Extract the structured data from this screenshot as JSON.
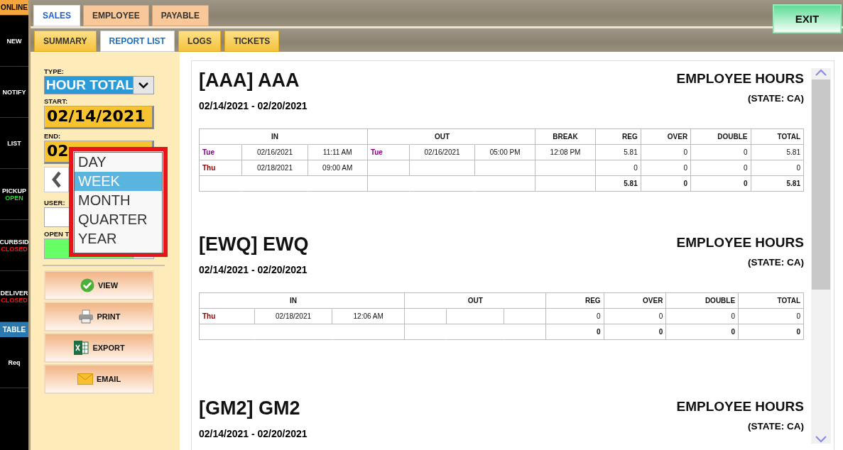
{
  "sidebar": {
    "items": [
      {
        "label": "ONLINE",
        "kind": "mode"
      },
      {
        "label": "NEW",
        "kind": "plain"
      },
      {
        "label": "NOTIFY",
        "kind": "plain"
      },
      {
        "label": "LIST",
        "kind": "plain"
      },
      {
        "label": "PICKUP",
        "kind": "service",
        "status": "OPEN",
        "open": true
      },
      {
        "label": "CURBSID",
        "kind": "service",
        "status": "CLOSED",
        "open": false
      },
      {
        "label": "DELIVER",
        "kind": "service",
        "status": "CLOSED",
        "open": false
      },
      {
        "label": "TABLE",
        "kind": "accent"
      },
      {
        "label": "Req",
        "kind": "plain"
      }
    ]
  },
  "tabs": [
    {
      "label": "SALES",
      "selected": true
    },
    {
      "label": "EMPLOYEE",
      "selected": false
    },
    {
      "label": "PAYABLE",
      "selected": false
    }
  ],
  "subtabs": [
    {
      "label": "SUMMARY",
      "selected": false
    },
    {
      "label": "REPORT LIST",
      "selected": true
    },
    {
      "label": "LOGS",
      "selected": false
    },
    {
      "label": "TICKETS",
      "selected": false
    }
  ],
  "exit_button": "EXIT",
  "filters": {
    "type_label": "TYPE:",
    "type_value": "HOUR TOTAL",
    "start_label": "START:",
    "start_value": "02/14/2021",
    "end_label": "END:",
    "end_value": "02",
    "user_label": "USER:",
    "open_label": "OPEN T"
  },
  "period_menu": [
    {
      "label": "DAY",
      "selected": false
    },
    {
      "label": "WEEK",
      "selected": true
    },
    {
      "label": "MONTH",
      "selected": false
    },
    {
      "label": "QUARTER",
      "selected": false
    },
    {
      "label": "YEAR",
      "selected": false
    }
  ],
  "actions": [
    {
      "label": "VIEW",
      "kind": "view"
    },
    {
      "label": "PRINT",
      "kind": "print"
    },
    {
      "label": "EXPORT",
      "kind": "export"
    },
    {
      "label": "EMAIL",
      "kind": "email"
    }
  ],
  "reports": [
    {
      "code": "[AAA] AAA",
      "heading": "EMPLOYEE HOURS",
      "range": "02/14/2021 - 02/20/2021",
      "state": "(STATE: CA)",
      "table": {
        "columns": [
          {
            "kind": "joined"
          },
          {
            "label": "IN",
            "kind": "joined"
          },
          {
            "kind": "empty"
          },
          {
            "kind": "joined"
          },
          {
            "label": "OUT",
            "kind": "joined"
          },
          {
            "kind": "empty"
          },
          {
            "label": "BREAK",
            "kind": "text"
          },
          {
            "label": "REG",
            "kind": "number"
          },
          {
            "label": "OVER",
            "kind": "number"
          },
          {
            "label": "DOUBLE",
            "kind": "number"
          },
          {
            "label": "TOTAL",
            "kind": "number"
          }
        ],
        "rows": [
          {
            "kind": "entry",
            "cells": [
              {
                "text": "Tue",
                "kind": "day",
                "color": "#800080"
              },
              {
                "text": "02/16/2021",
                "kind": "text"
              },
              {
                "text": "11:11 AM",
                "kind": "text"
              },
              {
                "text": "Tue",
                "kind": "day",
                "color": "#800080"
              },
              {
                "text": "02/16/2021",
                "kind": "text"
              },
              {
                "text": "05:00 PM",
                "kind": "text"
              },
              {
                "text": "12:08 PM",
                "kind": "text"
              },
              {
                "text": "5.81",
                "kind": "number"
              },
              {
                "text": "0",
                "kind": "number"
              },
              {
                "text": "0",
                "kind": "number"
              },
              {
                "text": "5.81",
                "kind": "number"
              }
            ]
          },
          {
            "kind": "entry",
            "cells": [
              {
                "text": "Thu",
                "kind": "day",
                "color": "#8b0000"
              },
              {
                "text": "02/18/2021",
                "kind": "text"
              },
              {
                "text": "09:00 AM",
                "kind": "text"
              },
              {
                "kind": "empty"
              },
              {
                "kind": "empty"
              },
              {
                "kind": "empty"
              },
              {
                "kind": "empty"
              },
              {
                "text": "0",
                "kind": "number"
              },
              {
                "text": "0",
                "kind": "number"
              },
              {
                "text": "0",
                "kind": "number"
              },
              {
                "text": "0",
                "kind": "number"
              }
            ]
          },
          {
            "kind": "total",
            "cells": [
              {
                "kind": "joined"
              },
              {
                "kind": "joined"
              },
              {
                "kind": "empty"
              },
              {
                "kind": "joined"
              },
              {
                "kind": "joined"
              },
              {
                "kind": "empty"
              },
              {
                "kind": "empty"
              },
              {
                "text": "5.81",
                "kind": "number"
              },
              {
                "text": "0",
                "kind": "number"
              },
              {
                "text": "0",
                "kind": "number"
              },
              {
                "text": "5.81",
                "kind": "number"
              }
            ]
          }
        ]
      }
    },
    {
      "code": "[EWQ] EWQ",
      "heading": "EMPLOYEE HOURS",
      "range": "02/14/2021 - 02/20/2021",
      "state": "(STATE: CA)",
      "table": {
        "columns": [
          {
            "kind": "joined"
          },
          {
            "label": "IN",
            "kind": "joined"
          },
          {
            "kind": "empty"
          },
          {
            "kind": "joined"
          },
          {
            "label": "OUT",
            "kind": "joined"
          },
          {
            "kind": "empty"
          },
          {
            "label": "REG",
            "kind": "number"
          },
          {
            "label": "OVER",
            "kind": "number"
          },
          {
            "label": "DOUBLE",
            "kind": "number"
          },
          {
            "label": "TOTAL",
            "kind": "number"
          }
        ],
        "rows": [
          {
            "kind": "entry",
            "cells": [
              {
                "text": "Thu",
                "kind": "day",
                "color": "#8b0000"
              },
              {
                "text": "02/18/2021",
                "kind": "text"
              },
              {
                "text": "12:06 AM",
                "kind": "text"
              },
              {
                "kind": "empty"
              },
              {
                "kind": "empty"
              },
              {
                "kind": "empty"
              },
              {
                "text": "0",
                "kind": "number"
              },
              {
                "text": "0",
                "kind": "number"
              },
              {
                "text": "0",
                "kind": "number"
              },
              {
                "text": "0",
                "kind": "number"
              }
            ]
          },
          {
            "kind": "total",
            "cells": [
              {
                "kind": "joined"
              },
              {
                "kind": "joined"
              },
              {
                "kind": "empty"
              },
              {
                "kind": "joined"
              },
              {
                "kind": "joined"
              },
              {
                "kind": "empty"
              },
              {
                "text": "0",
                "kind": "number"
              },
              {
                "text": "0",
                "kind": "number"
              },
              {
                "text": "0",
                "kind": "number"
              },
              {
                "text": "0",
                "kind": "number"
              }
            ]
          }
        ]
      }
    },
    {
      "code": "[GM2] GM2",
      "heading": "EMPLOYEE HOURS",
      "range": "02/14/2021 - 02/20/2021",
      "state": "(STATE: CA)"
    }
  ]
}
